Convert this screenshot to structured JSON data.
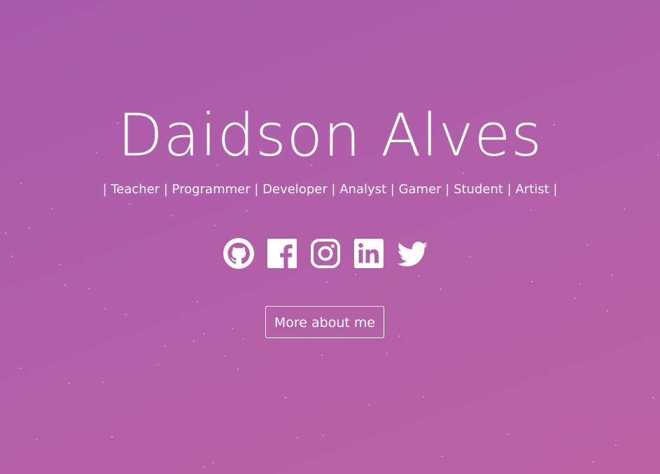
{
  "hero": {
    "name": "Daidson Alves",
    "roles": "| Teacher | Programmer | Developer | Analyst | Gamer | Student | Artist |"
  },
  "socials": [
    {
      "icon": "github-icon"
    },
    {
      "icon": "facebook-icon"
    },
    {
      "icon": "instagram-icon"
    },
    {
      "icon": "linkedin-icon"
    },
    {
      "icon": "twitter-icon"
    }
  ],
  "more_button": {
    "label": "More about me"
  },
  "colors": {
    "background_start": "#a85aad",
    "background_end": "#bb62a2",
    "text": "#ffffff"
  }
}
